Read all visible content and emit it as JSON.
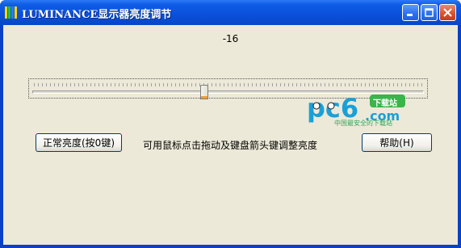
{
  "window": {
    "title": "LUMINANCE显示器亮度调节",
    "controls": {
      "minimize": "minimize-icon",
      "maximize": "maximize-icon",
      "close": "close-icon"
    }
  },
  "brightness": {
    "value_label": "-16",
    "level": -16
  },
  "buttons": {
    "normal": "正常亮度(按0键)",
    "help": "帮助(H)"
  },
  "hint": "可用鼠标点击拖动及键盘箭头键调整亮度",
  "watermark": {
    "logo": "pc6.com",
    "badge": "下载站",
    "subtitle": "中国最安全的下载站"
  },
  "colors": {
    "titlebar": "#0a4fda",
    "client": "#ece9d8",
    "watermark": "#1aa0d8"
  }
}
